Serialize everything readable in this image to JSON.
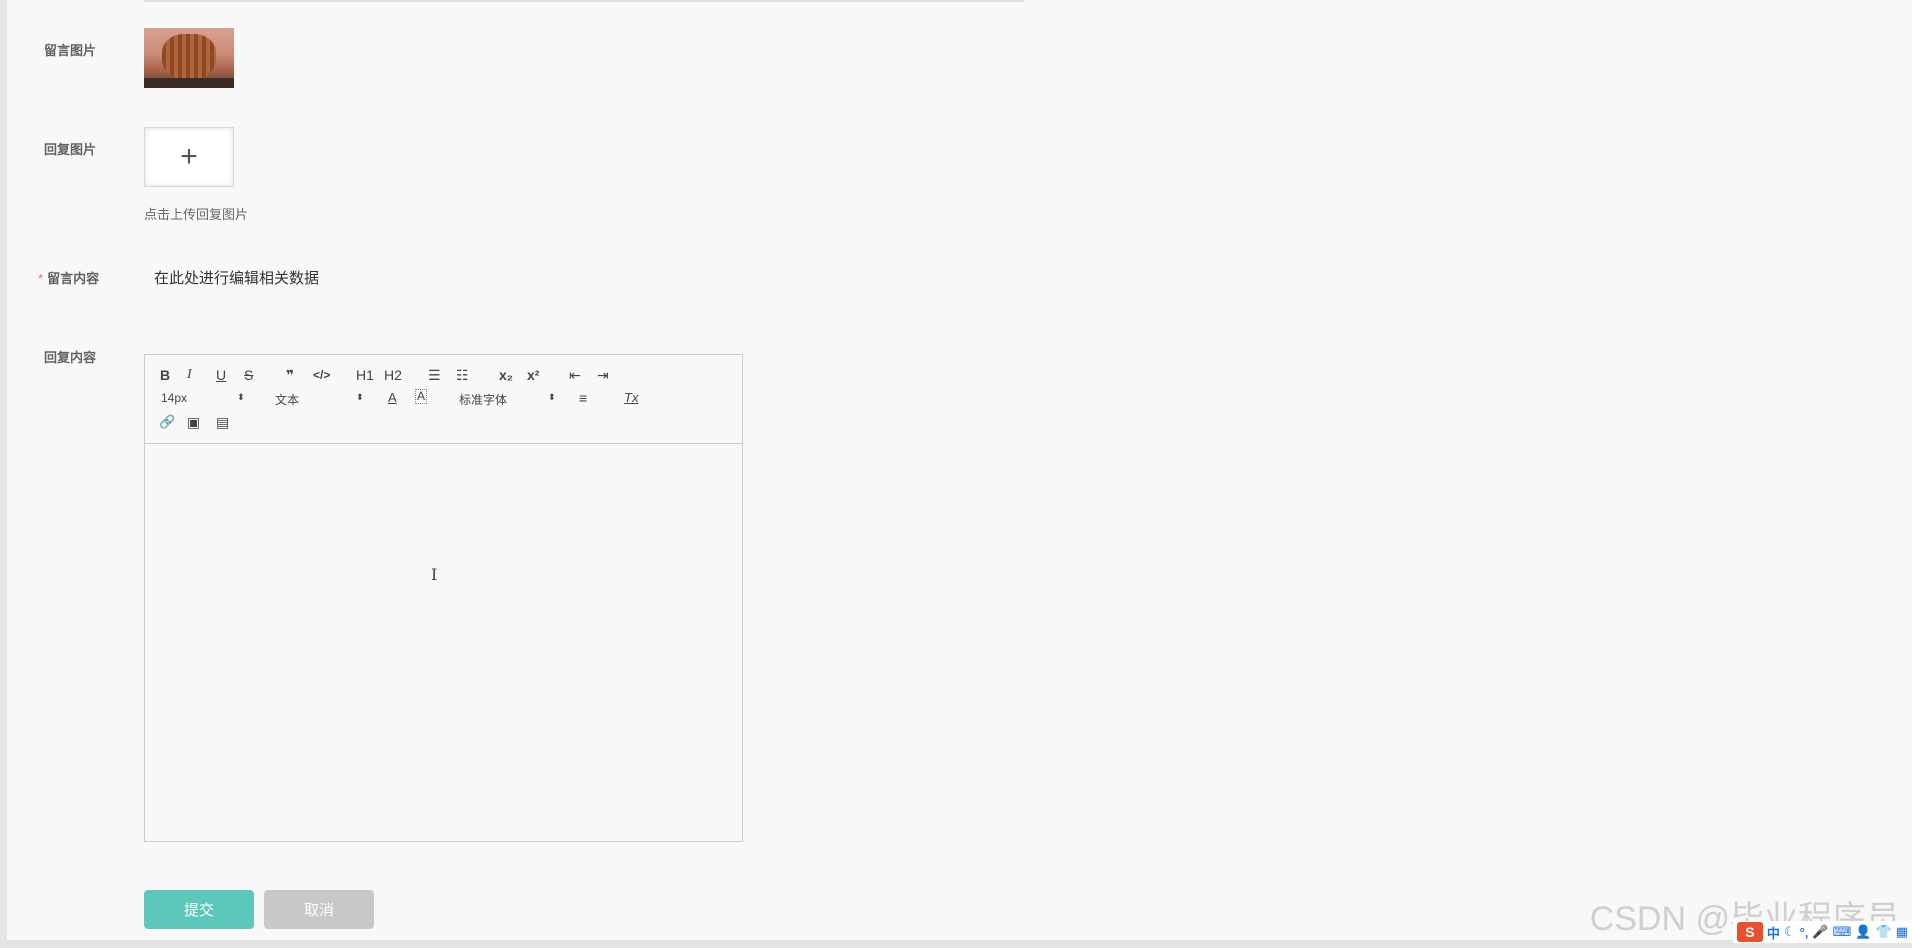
{
  "form": {
    "message_image_label": "留言图片",
    "reply_image_label": "回复图片",
    "upload_plus": "+",
    "upload_tip": "点击上传回复图片",
    "required_mark": "*",
    "message_content_label": "留言内容",
    "message_content_value": "在此处进行编辑相关数据",
    "reply_content_label": "回复内容"
  },
  "editor": {
    "toolbar_row1": {
      "bold": "B",
      "italic": "I",
      "underline": "U",
      "strike": "S",
      "blockquote": "❞",
      "code": "</>",
      "h1": "H1",
      "h2": "H2",
      "ordered_list": "☰",
      "bullet_list": "☷",
      "subscript": "x₂",
      "superscript": "x²",
      "outdent": "⇤",
      "indent": "⇥"
    },
    "toolbar_row2": {
      "size": "14px",
      "header": "文本",
      "font_color": "A",
      "background_color": "A",
      "font": "标准字体",
      "align": "≡",
      "clean": "Tx"
    },
    "toolbar_row3": {
      "link": "🔗",
      "image": "▣",
      "video": "▤"
    },
    "cursor": "I"
  },
  "buttons": {
    "submit": "提交",
    "cancel": "取消"
  },
  "watermark": "CSDN @毕业程序员",
  "tray": {
    "logo": "S",
    "lang": "中",
    "moon": "☾",
    "punct": "°,",
    "mic": "🎤",
    "keyboard": "⌨",
    "user": "👤",
    "shirt": "👕",
    "grid": "▦"
  }
}
